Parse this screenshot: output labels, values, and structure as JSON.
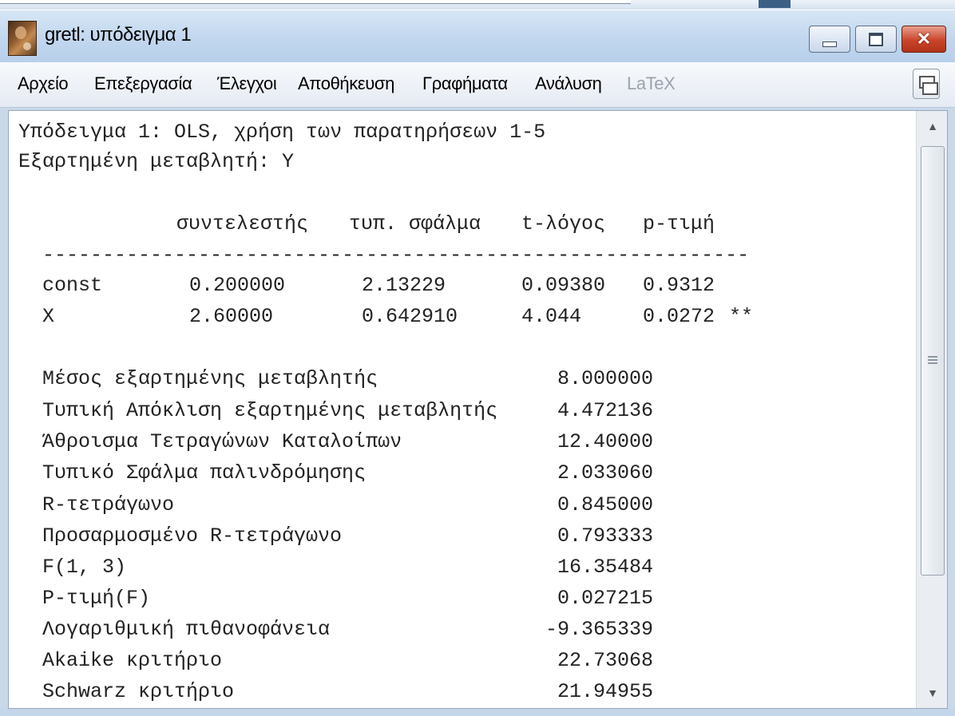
{
  "window": {
    "title": "gretl: υπόδειγμα 1",
    "icon": "gretl-app-icon"
  },
  "menu": [
    {
      "label": "Αρχείο",
      "enabled": true
    },
    {
      "label": "Επεξεργασία",
      "enabled": true
    },
    {
      "label": "Έλεγχοι",
      "enabled": true
    },
    {
      "label": "Αποθήκευση",
      "enabled": true
    },
    {
      "label": "Γραφήματα",
      "enabled": true
    },
    {
      "label": "Ανάλυση",
      "enabled": true
    },
    {
      "label": "LaTeX",
      "enabled": false
    }
  ],
  "output": {
    "header1": "Υπόδειγμα 1: OLS, χρήση των παρατηρήσεων 1-5",
    "header2": "Εξαρτημένη μεταβλητή: Y",
    "columns": [
      "συντελεστής",
      "τυπ. σφάλμα",
      "t-λόγος",
      "p-τιμή"
    ],
    "separator": "-----------------------------------------------------------",
    "rows": [
      {
        "name": "const",
        "coef": "0.200000",
        "se": "2.13229",
        "t": "0.09380",
        "p": "0.9312",
        "stars": ""
      },
      {
        "name": "X",
        "coef": "2.60000",
        "se": "0.642910",
        "t": "4.044",
        "p": "0.0272",
        "stars": "**"
      }
    ],
    "stats": [
      {
        "label": "Μέσος εξαρτημένης μεταβλητής",
        "value": "8.000000"
      },
      {
        "label": "Τυπική Απόκλιση εξαρτημένης μεταβλητής",
        "value": "4.472136"
      },
      {
        "label": "Άθροισμα Τετραγώνων Καταλοίπων",
        "value": "12.40000"
      },
      {
        "label": "Τυπικό Σφάλμα παλινδρόμησης",
        "value": "2.033060"
      },
      {
        "label": "R-τετράγωνο",
        "value": "0.845000"
      },
      {
        "label": "Προσαρμοσμένο R-τετράγωνο",
        "value": "0.793333"
      },
      {
        "label": "F(1, 3)",
        "value": "16.35484"
      },
      {
        "label": "P-τιμή(F)",
        "value": "0.027215"
      },
      {
        "label": "Λογαριθμική πιθανοφάνεια",
        "value": "-9.365339"
      },
      {
        "label": "Akaike κριτήριο",
        "value": "22.73068"
      },
      {
        "label": "Schwarz κριτήριο",
        "value": "21.94955"
      }
    ]
  }
}
